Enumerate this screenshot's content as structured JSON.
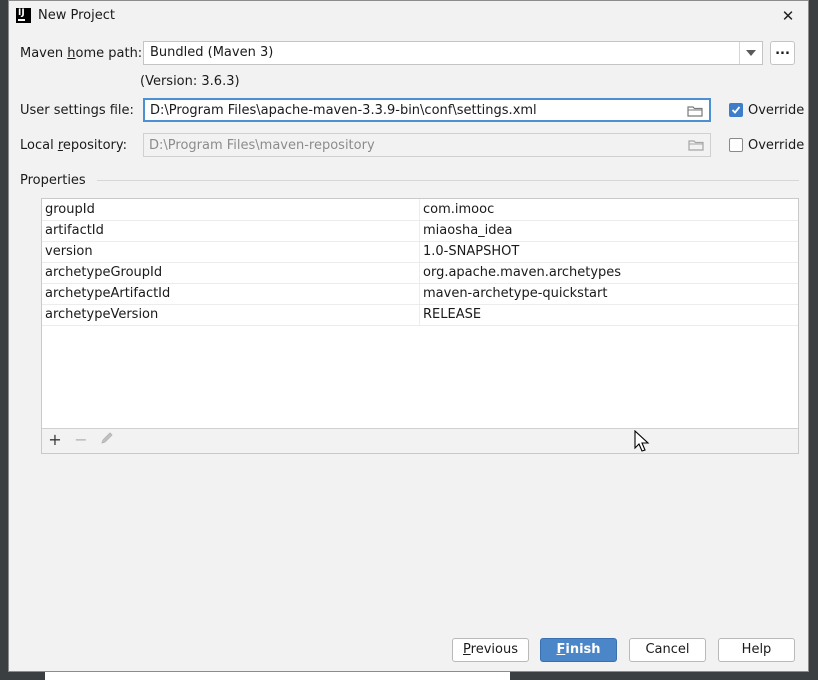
{
  "window": {
    "title": "New Project",
    "close_glyph": "✕",
    "logo_text": "IJ"
  },
  "maven_home": {
    "label_before": "Maven ",
    "label_mnemonic": "h",
    "label_after": "ome path:",
    "value": "Bundled (Maven 3)",
    "browse": "...",
    "version": "(Version: 3.6.3)"
  },
  "user_settings": {
    "label": "User settings file:",
    "value": "D:\\Program Files\\apache-maven-3.3.9-bin\\conf\\settings.xml",
    "override_label": "Override",
    "override_checked": true
  },
  "local_repo": {
    "label_before": "Local ",
    "label_mnemonic": "r",
    "label_after": "epository:",
    "value": "D:\\Program Files\\maven-repository",
    "override_label": "Override",
    "override_checked": false
  },
  "properties": {
    "heading": "Properties",
    "rows": [
      {
        "key": "groupId",
        "value": "com.imooc"
      },
      {
        "key": "artifactId",
        "value": "miaosha_idea"
      },
      {
        "key": "version",
        "value": "1.0-SNAPSHOT"
      },
      {
        "key": "archetypeGroupId",
        "value": "org.apache.maven.archetypes"
      },
      {
        "key": "archetypeArtifactId",
        "value": "maven-archetype-quickstart"
      },
      {
        "key": "archetypeVersion",
        "value": "RELEASE"
      }
    ],
    "tools": {
      "add": "+",
      "remove": "−",
      "edit_icon": "pencil-icon"
    }
  },
  "buttons": {
    "previous_mnemonic": "P",
    "previous_rest": "revious",
    "finish_mnemonic": "F",
    "finish_rest": "inish",
    "cancel": "Cancel",
    "help": "Help"
  },
  "colors": {
    "accent": "#4a86c8",
    "focus": "#4d8fd3",
    "checkbox": "#3d7dc9"
  }
}
